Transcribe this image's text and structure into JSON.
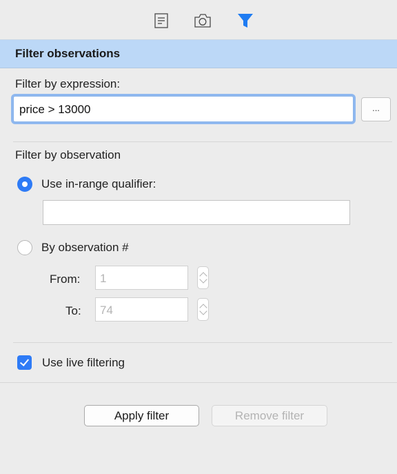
{
  "toolbar": {
    "icons": [
      "document-icon",
      "camera-icon",
      "filter-icon"
    ],
    "active_icon": "filter-icon",
    "accent": "#1f7cf2"
  },
  "header": {
    "title": "Filter observations"
  },
  "expression": {
    "label": "Filter by expression:",
    "value": "price > 13000",
    "browse_label": "..."
  },
  "observation": {
    "label": "Filter by observation",
    "in_range": {
      "label": "Use in-range qualifier:",
      "selected": true,
      "value": ""
    },
    "by_number": {
      "label": "By observation #",
      "selected": false,
      "from_label": "From:",
      "from_value": "1",
      "to_label": "To:",
      "to_value": "74"
    }
  },
  "live_filtering": {
    "label": "Use live filtering",
    "checked": true
  },
  "buttons": {
    "apply": "Apply filter",
    "remove": "Remove filter"
  }
}
